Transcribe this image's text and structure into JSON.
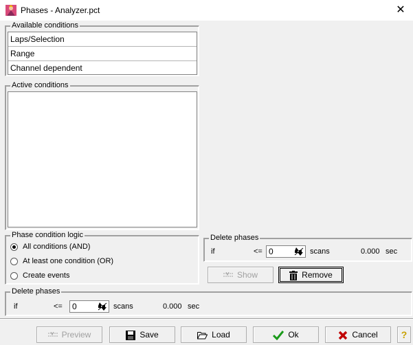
{
  "window": {
    "title": "Phases - Analyzer.pct",
    "close_glyph": "✕"
  },
  "available_conditions": {
    "legend": "Available conditions",
    "items": [
      "Laps/Selection",
      "Range",
      "Channel dependent"
    ]
  },
  "active_conditions": {
    "legend": "Active conditions",
    "items": []
  },
  "phase_condition_logic": {
    "legend": "Phase condition logic",
    "options": [
      "All conditions (AND)",
      "At least one condition (OR)",
      "Create events"
    ],
    "selected": "All conditions (AND)"
  },
  "condition_delete_phases": {
    "legend": "Delete phases",
    "if_label": "if",
    "operator": "<=",
    "value": "0",
    "unit": "scans",
    "seconds": "0.000",
    "seconds_unit": "sec"
  },
  "condition_buttons": {
    "show": "Show",
    "remove": "Remove"
  },
  "global_delete_phases": {
    "legend": "Delete phases",
    "if_label": "if",
    "operator": "<=",
    "value": "0",
    "unit": "scans",
    "seconds": "0.000",
    "seconds_unit": "sec"
  },
  "footer": {
    "preview": "Preview",
    "save": "Save",
    "load": "Load",
    "ok": "Ok",
    "cancel": "Cancel",
    "help": "?"
  },
  "colors": {
    "ok_check": "#1a9a1a",
    "cancel_x": "#c00000",
    "help_q": "#c8a000"
  }
}
